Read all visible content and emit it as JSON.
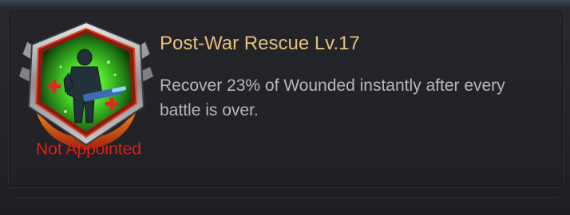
{
  "skill": {
    "title": "Post-War Rescue Lv.17",
    "description": "Recover 23% of Wounded instantly after every battle is over.",
    "status": "Not Appointed",
    "icon": "rescue-soldier-badge-icon"
  },
  "colors": {
    "title": "#e6c07e",
    "description": "#b7b8bc",
    "status": "#e0231c",
    "badge_glow": "#4bdc2b",
    "panel_bg": "#222326"
  }
}
